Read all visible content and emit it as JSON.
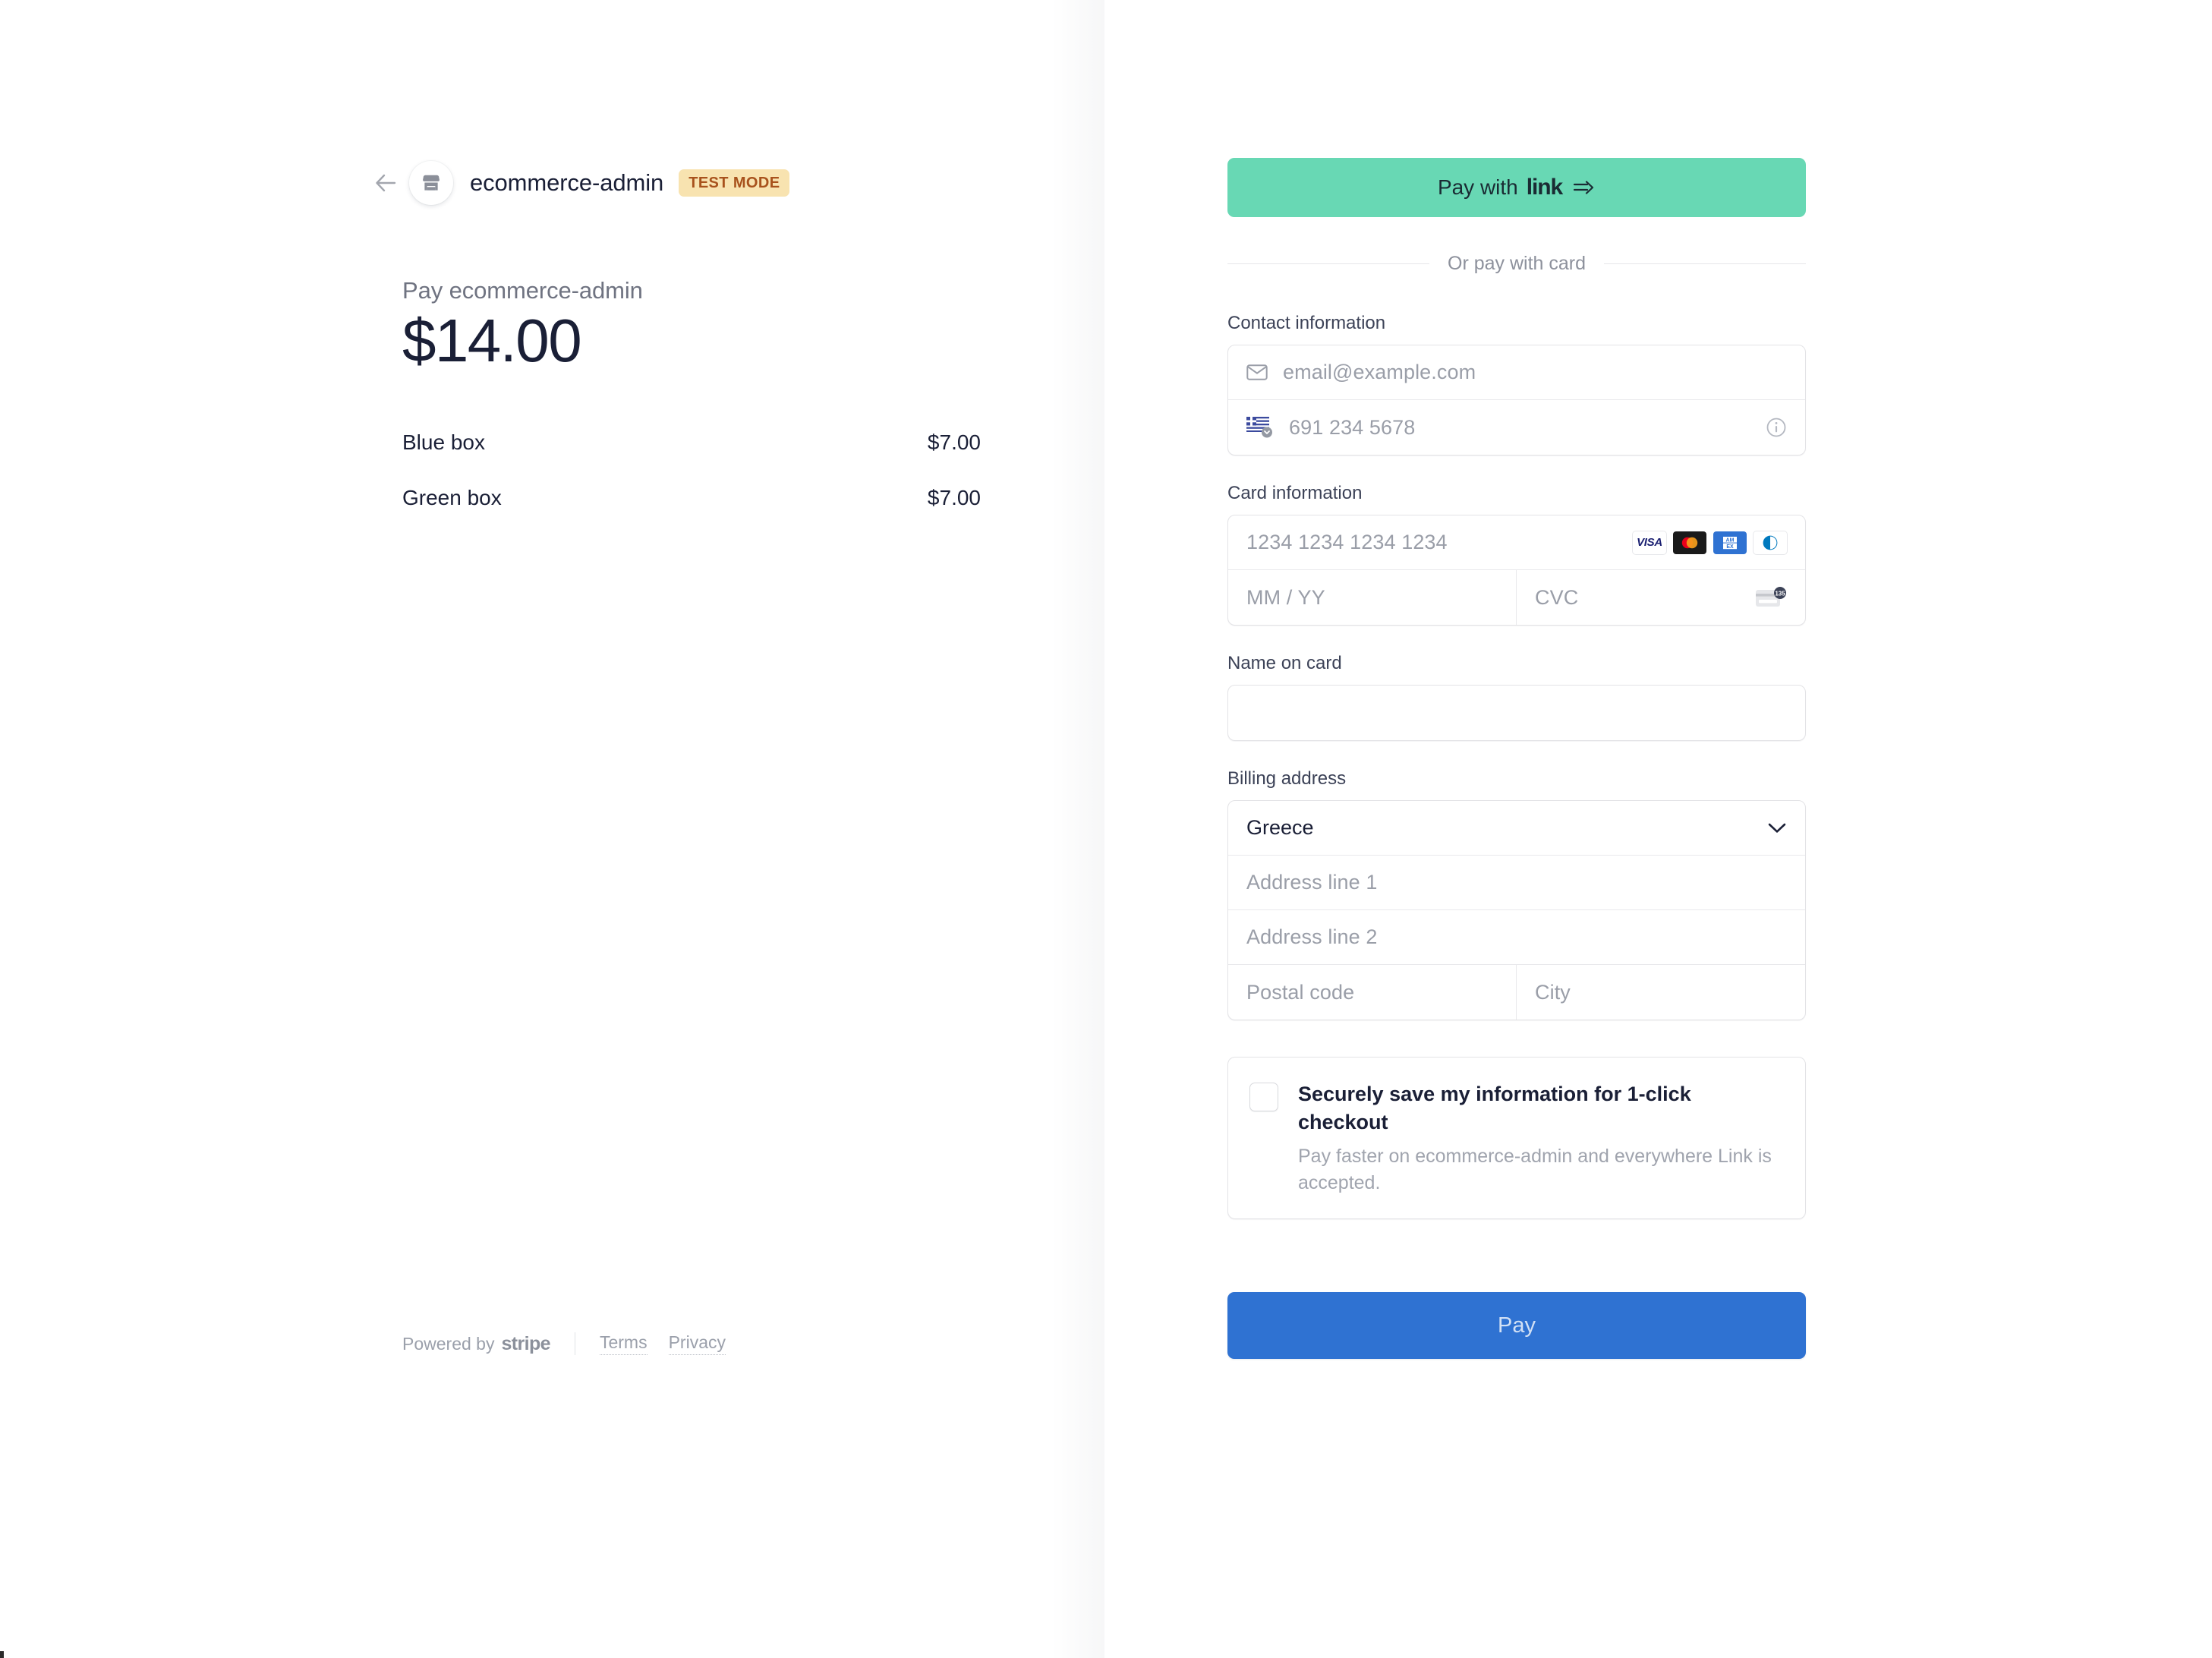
{
  "merchant": {
    "back_icon": "arrow-left-icon",
    "avatar_icon": "storefront-icon",
    "name": "ecommerce-admin",
    "test_badge": "TEST MODE"
  },
  "summary": {
    "pay_to_label": "Pay ecommerce-admin",
    "amount": "$14.00",
    "items": [
      {
        "name": "Blue box",
        "price": "$7.00"
      },
      {
        "name": "Green box",
        "price": "$7.00"
      }
    ]
  },
  "footer": {
    "powered_by": "Powered by",
    "stripe": "stripe",
    "terms": "Terms",
    "privacy": "Privacy"
  },
  "payment": {
    "link_button": {
      "prefix": "Pay with",
      "logo": "link",
      "arrow_icon": "link-arrow-icon"
    },
    "divider_text": "Or pay with card",
    "contact": {
      "label": "Contact information",
      "email_icon": "envelope-icon",
      "email_placeholder": "email@example.com",
      "email_value": "",
      "phone_flag_icon": "greece-flag-icon",
      "phone_placeholder": "691 234 5678",
      "phone_value": "",
      "info_icon": "info-circle-icon"
    },
    "card": {
      "label": "Card information",
      "number_placeholder": "1234 1234 1234 1234",
      "number_value": "",
      "expiry_placeholder": "MM / YY",
      "expiry_value": "",
      "cvc_placeholder": "CVC",
      "cvc_value": "",
      "cvc_hint_number": "135",
      "cvc_icon": "cvc-card-icon",
      "brands": [
        "VISA",
        "mastercard-icon",
        "AMEX",
        "diners-club-icon"
      ],
      "visa_text": "VISA",
      "amex_line1": "AM",
      "amex_line2": "EX"
    },
    "name_on_card": {
      "label": "Name on card",
      "value": "",
      "placeholder": ""
    },
    "billing": {
      "label": "Billing address",
      "country_value": "Greece",
      "country_chevron_icon": "chevron-down-icon",
      "address1_placeholder": "Address line 1",
      "address1_value": "",
      "address2_placeholder": "Address line 2",
      "address2_value": "",
      "postal_placeholder": "Postal code",
      "postal_value": "",
      "city_placeholder": "City",
      "city_value": ""
    },
    "save_info": {
      "checked": false,
      "title": "Securely save my information for 1-click checkout",
      "subtitle": "Pay faster on ecommerce-admin and everywhere Link is accepted."
    },
    "pay_button_label": "Pay"
  },
  "colors": {
    "link_green": "#68d8b4",
    "pay_blue": "#2f72d2",
    "test_badge_bg": "#f8e3b0",
    "test_badge_text": "#a8521c",
    "text_dark": "#1a1f36",
    "text_muted": "#6f7381",
    "placeholder": "#9a9ea8"
  }
}
